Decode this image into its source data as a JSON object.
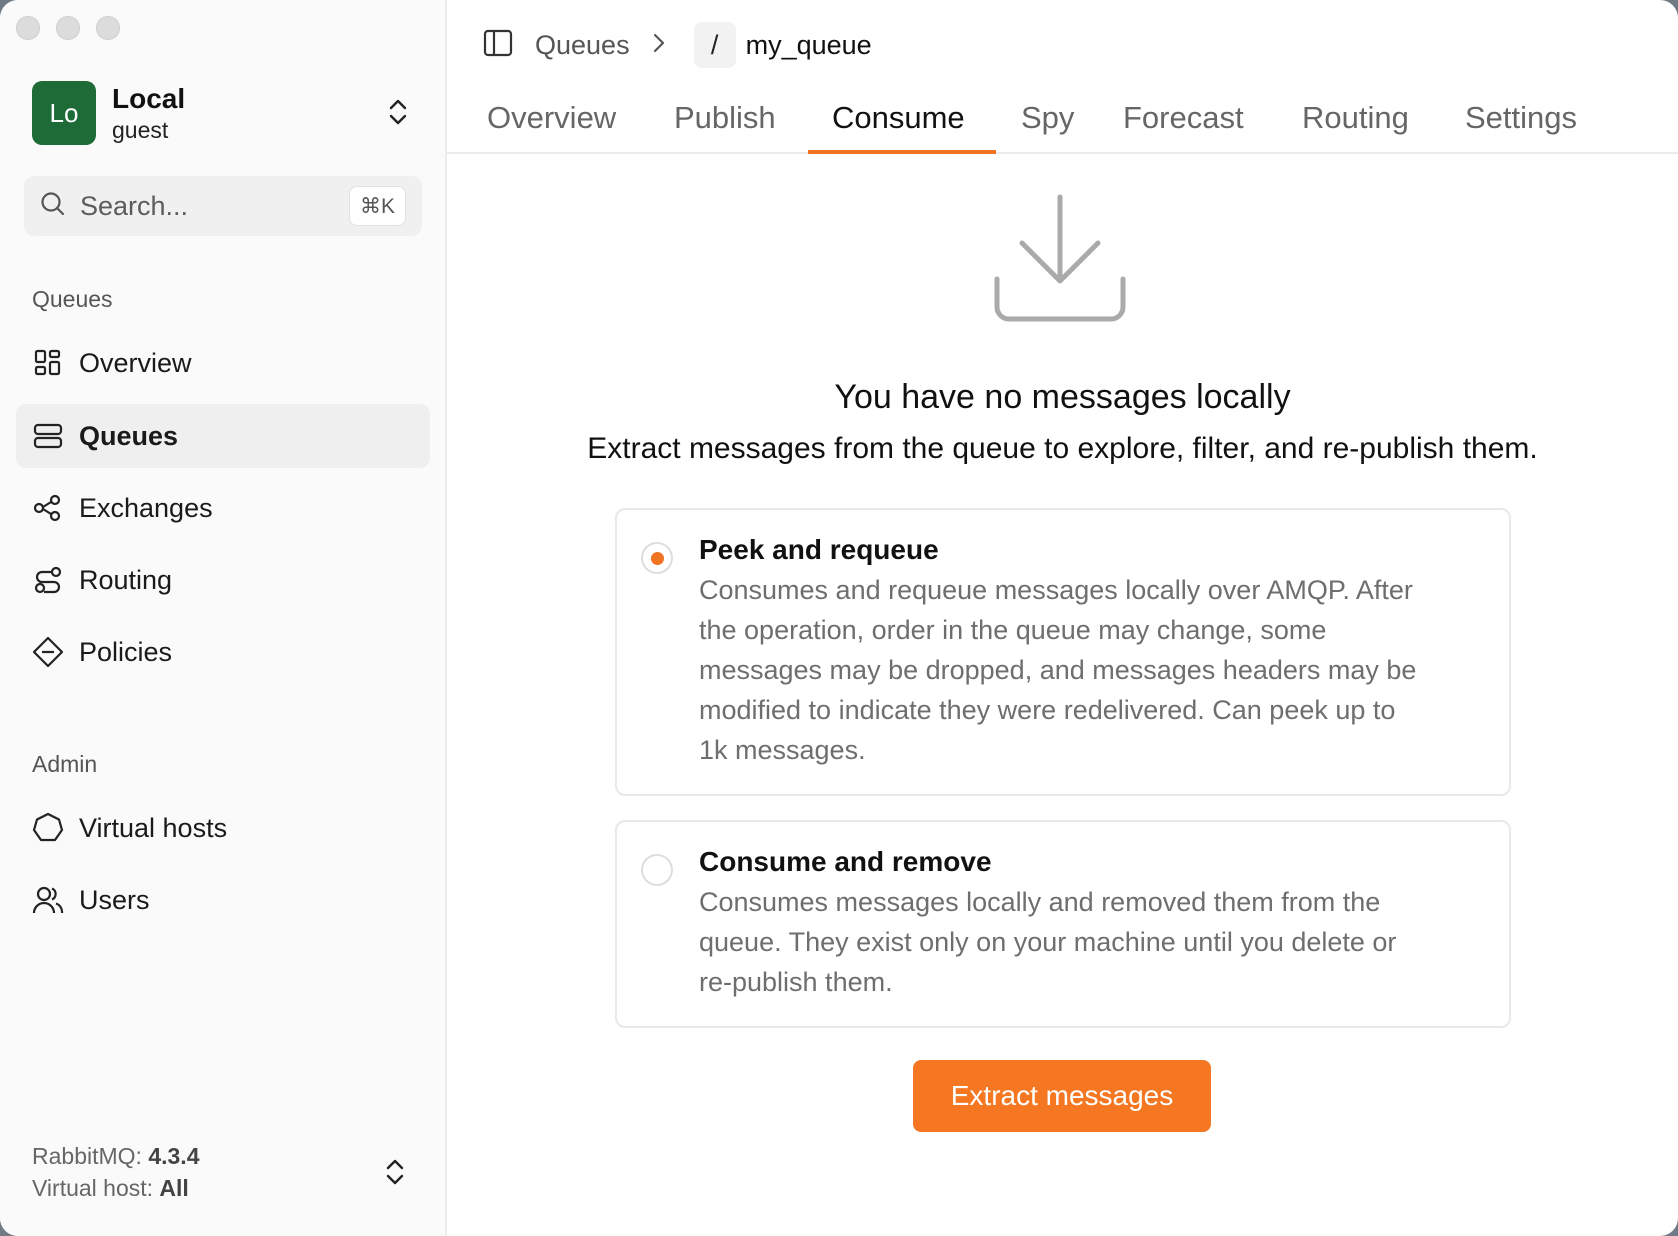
{
  "account": {
    "initials": "Lo",
    "name": "Local",
    "user": "guest"
  },
  "search": {
    "placeholder": "Search...",
    "shortcut": "⌘K"
  },
  "sidebar": {
    "section_queues": "Queues",
    "items": [
      {
        "label": "Overview",
        "icon": "grid-icon"
      },
      {
        "label": "Queues",
        "icon": "stack-icon",
        "active": true
      },
      {
        "label": "Exchanges",
        "icon": "share-nodes-icon"
      },
      {
        "label": "Routing",
        "icon": "route-icon"
      },
      {
        "label": "Policies",
        "icon": "diamond-icon"
      }
    ],
    "section_admin": "Admin",
    "admin_items": [
      {
        "label": "Virtual hosts",
        "icon": "hexagon-icon"
      },
      {
        "label": "Users",
        "icon": "users-icon"
      }
    ]
  },
  "footer": {
    "rabbitmq_label": "RabbitMQ:",
    "rabbitmq_version": "4.3.4",
    "vhost_label": "Virtual host:",
    "vhost_value": "All"
  },
  "breadcrumb": {
    "parent": "Queues",
    "vhost": "/",
    "current": "my_queue"
  },
  "tabs": [
    "Overview",
    "Publish",
    "Consume",
    "Spy",
    "Forecast",
    "Routing",
    "Settings"
  ],
  "active_tab": "Consume",
  "empty": {
    "title": "You have no messages locally",
    "subtitle": "Extract messages from the queue to explore, filter, and re-publish them."
  },
  "options": [
    {
      "title": "Peek and requeue",
      "desc_lines": [
        "Consumes and requeue messages locally over AMQP. After",
        "the operation, order in the queue may change, some",
        "messages may be dropped, and messages headers may be",
        "modified to indicate they were redelivered. Can peek up to",
        "1k messages."
      ],
      "selected": true
    },
    {
      "title": "Consume and remove",
      "desc_lines": [
        "Consumes messages locally and removed them from the",
        "queue. They exist only on your machine until you delete or",
        "re-publish them."
      ],
      "selected": false
    }
  ],
  "button": {
    "label": "Extract messages"
  },
  "colors": {
    "accent": "#f57722",
    "avatar": "#1f6b38"
  }
}
